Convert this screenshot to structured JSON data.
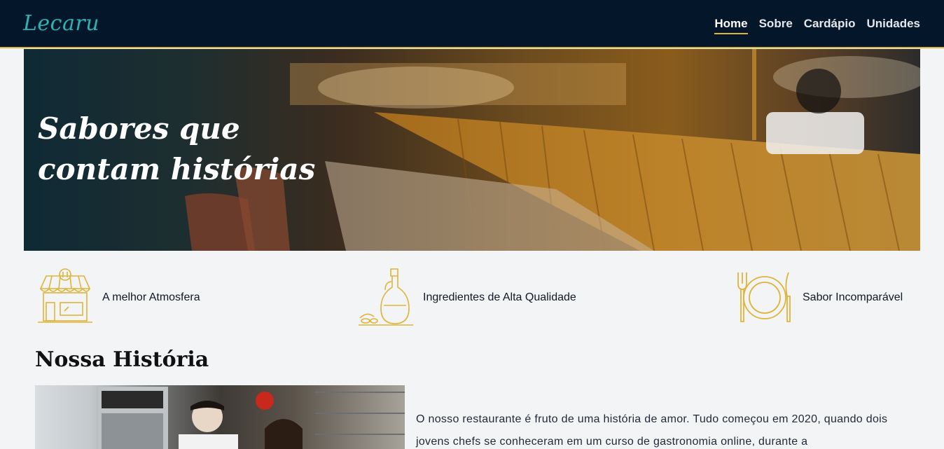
{
  "brand": {
    "name": "Lecaru"
  },
  "nav": {
    "items": [
      {
        "label": "Home",
        "active": true
      },
      {
        "label": "Sobre",
        "active": false
      },
      {
        "label": "Cardápio",
        "active": false
      },
      {
        "label": "Unidades",
        "active": false
      }
    ]
  },
  "hero": {
    "title": "Sabores que contam histórias"
  },
  "features": [
    {
      "icon": "storefront-icon",
      "label": "A melhor Atmosfera"
    },
    {
      "icon": "olive-oil-bottle-icon",
      "label": "Ingredientes de Alta Qualidade"
    },
    {
      "icon": "plate-cutlery-icon",
      "label": "Sabor Incomparável"
    }
  ],
  "story": {
    "title": "Nossa História",
    "text": "O nosso restaurante é fruto de uma história de amor. Tudo começou em 2020, quando dois jovens chefs se conheceram em um curso de gastronomia online, durante a"
  },
  "colors": {
    "navbar": "#04172a",
    "accent": "#e0b437",
    "brand": "#2bb3b3",
    "background": "#f3f4f6"
  }
}
